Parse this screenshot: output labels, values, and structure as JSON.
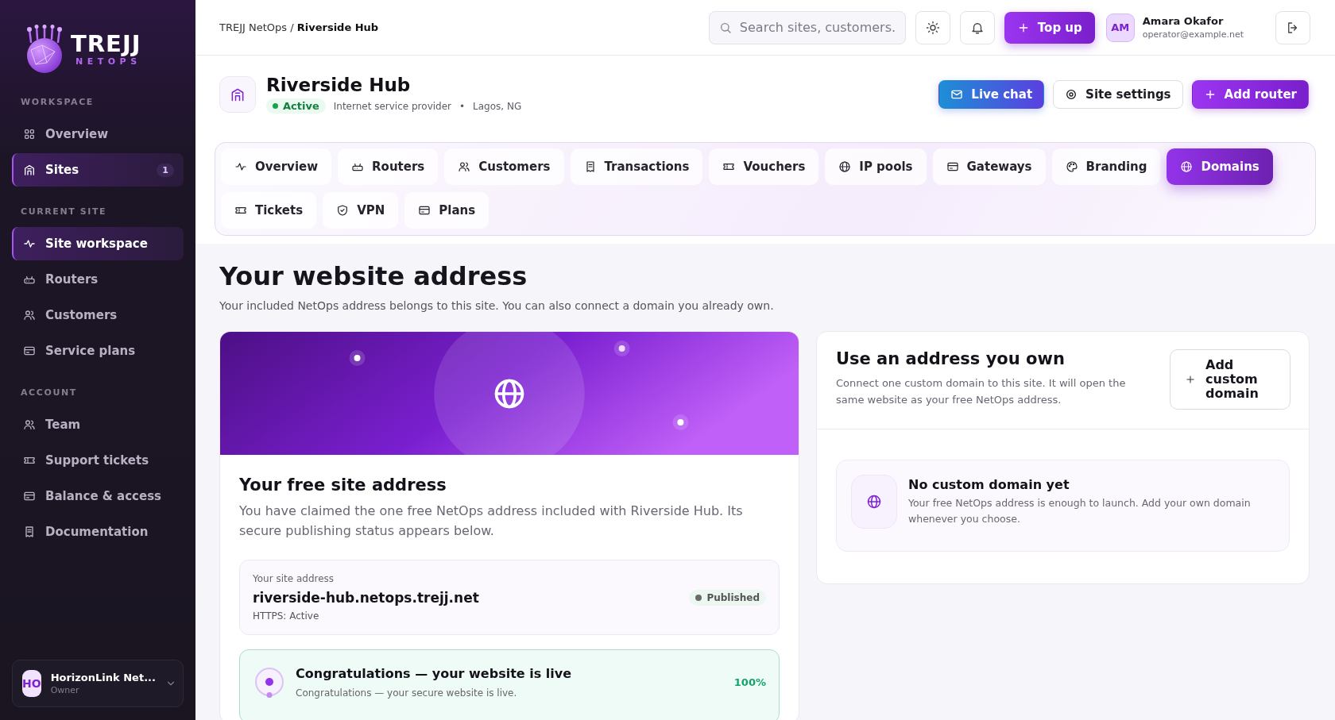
{
  "brand": {
    "name": "TREJJ",
    "subtitle": "NETOPS"
  },
  "sidebar": {
    "sections": [
      {
        "heading": "WORKSPACE",
        "items": [
          {
            "label": "Overview",
            "selected": false
          },
          {
            "label": "Sites",
            "selected": true,
            "badge": "1"
          }
        ]
      },
      {
        "heading": "CURRENT SITE",
        "items": [
          {
            "label": "Site workspace",
            "selected": true
          },
          {
            "label": "Routers",
            "selected": false
          },
          {
            "label": "Customers",
            "selected": false
          },
          {
            "label": "Service plans",
            "selected": false
          }
        ]
      },
      {
        "heading": "ACCOUNT",
        "items": [
          {
            "label": "Team",
            "selected": false
          },
          {
            "label": "Support tickets",
            "selected": false
          },
          {
            "label": "Balance & access",
            "selected": false
          },
          {
            "label": "Documentation",
            "selected": false
          }
        ]
      }
    ]
  },
  "account_switcher": {
    "initials": "HO",
    "name": "HorizonLink Net...",
    "role": "Owner"
  },
  "breadcrumb": {
    "parent": "TREJJ NetOps",
    "separator": "/",
    "current": "Riverside Hub"
  },
  "search": {
    "placeholder": "Search sites, customers."
  },
  "top_up_button": "Top up",
  "user": {
    "initials": "AM",
    "name": "Amara Okafor",
    "email": "operator@example.net"
  },
  "site": {
    "title": "Riverside Hub",
    "status": "Active",
    "type": "Internet service provider",
    "separator": "•",
    "location": "Lagos, NG"
  },
  "actions": [
    {
      "label": "Live chat",
      "kind": "chat"
    },
    {
      "label": "Site settings",
      "kind": "secondary"
    },
    {
      "label": "Add router",
      "kind": "primary"
    }
  ],
  "tabs": [
    {
      "label": "Overview",
      "selected": false
    },
    {
      "label": "Routers",
      "selected": false
    },
    {
      "label": "Customers",
      "selected": false
    },
    {
      "label": "Transactions",
      "selected": false
    },
    {
      "label": "Vouchers",
      "selected": false
    },
    {
      "label": "IP pools",
      "selected": false
    },
    {
      "label": "Gateways",
      "selected": false
    },
    {
      "label": "Branding",
      "selected": false
    },
    {
      "label": "Domains",
      "selected": true
    },
    {
      "label": "Tickets",
      "selected": false
    },
    {
      "label": "VPN",
      "selected": false
    },
    {
      "label": "Plans",
      "selected": false
    }
  ],
  "page": {
    "title": "Your website address",
    "subtitle": "Your included NetOps address belongs to this site. You can also connect a domain you already own."
  },
  "free_address": {
    "title": "Your free site address",
    "description": "You have claimed the one free NetOps address included with Riverside Hub. Its secure publishing status appears below.",
    "address_label": "Your site address",
    "address": "riverside-hub.netops.trejj.net",
    "https_status": "HTTPS: Active",
    "publish_status": "Published",
    "progress": {
      "title": "Congratulations — your website is live",
      "description": "Congratulations — your secure website is live.",
      "percent": "100%"
    }
  },
  "custom_domain": {
    "title": "Use an address you own",
    "description": "Connect one custom domain to this site. It will open the same website as your free NetOps address.",
    "add_button": "Add custom domain",
    "empty_title": "No custom domain yet",
    "empty_description": "Your free NetOps address is enough to launch. Add your own domain whenever you choose."
  }
}
